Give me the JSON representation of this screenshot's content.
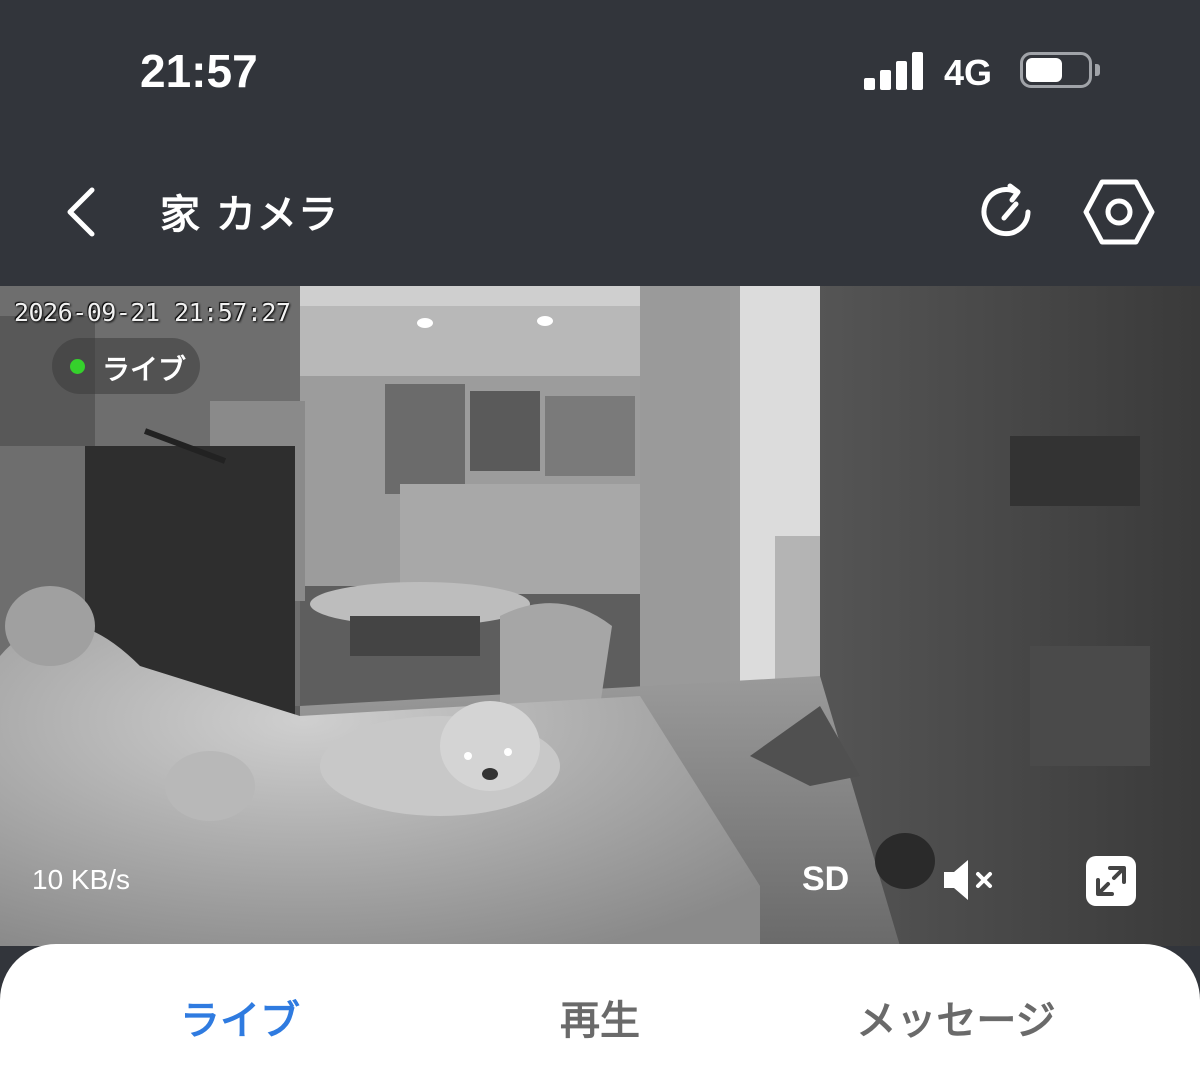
{
  "status_bar": {
    "time": "21:57",
    "network": "4G",
    "battery_level": 0.6
  },
  "header": {
    "title": "家 カメラ",
    "icons": [
      "chevron-left-icon",
      "refresh-icon",
      "hexagon-settings-icon"
    ]
  },
  "video": {
    "timestamp": "2026-09-21 21:57:27",
    "live_label": "ライブ",
    "live_color": "#35d12c",
    "bitrate": "10 KB/s",
    "quality": "SD",
    "icons": [
      "mute-icon",
      "fullscreen-icon"
    ]
  },
  "tabs": [
    {
      "label": "ライブ",
      "active": true
    },
    {
      "label": "再生",
      "active": false
    },
    {
      "label": "メッセージ",
      "active": false
    }
  ],
  "colors": {
    "header_bg": "#32353b",
    "active_tab": "#2f7be0",
    "inactive_tab": "#6a6a6a"
  }
}
